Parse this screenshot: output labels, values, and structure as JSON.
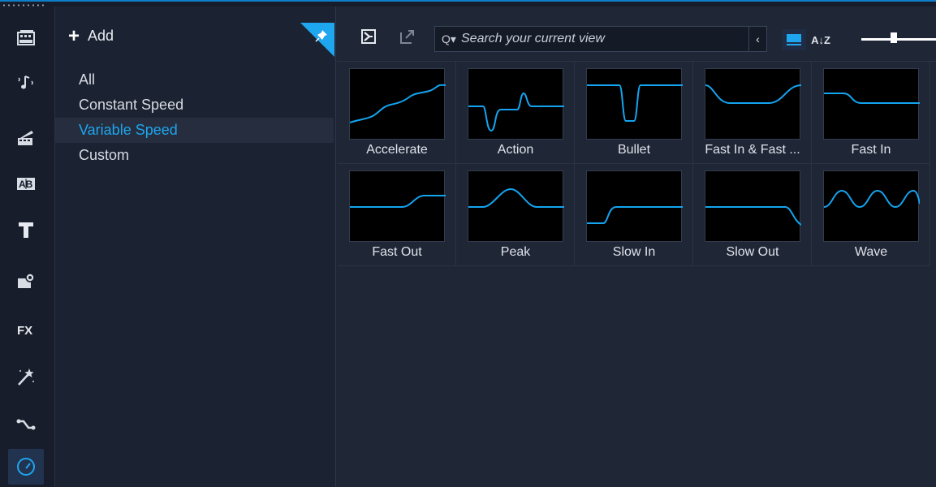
{
  "colors": {
    "accent": "#1ea6ee",
    "curve": "#14a4f0",
    "selected_category": "#1ea6ee"
  },
  "iconbar": {
    "items": [
      {
        "name": "media-icon"
      },
      {
        "name": "audio-icon"
      },
      {
        "name": "instant-project-icon"
      },
      {
        "name": "title-ab-icon",
        "text": "AB"
      },
      {
        "name": "text-icon",
        "text": "T"
      },
      {
        "name": "graphics-icon"
      },
      {
        "name": "fx-icon",
        "text": "FX"
      },
      {
        "name": "magic-wand-icon"
      },
      {
        "name": "motion-path-icon"
      },
      {
        "name": "speed-gauge-icon",
        "active": true
      }
    ]
  },
  "categories": {
    "add_label": "Add",
    "items": [
      "All",
      "Constant Speed",
      "Variable Speed",
      "Custom"
    ],
    "selected": "Variable Speed"
  },
  "toolbar": {
    "search_placeholder": "Search your current view",
    "search_icon_text": "Q▾",
    "clear_text": "‹",
    "sort_text": "A↓Z"
  },
  "presets": [
    {
      "label": "Accelerate"
    },
    {
      "label": "Action"
    },
    {
      "label": "Bullet"
    },
    {
      "label": "Fast In & Fast ..."
    },
    {
      "label": "Fast In"
    },
    {
      "label": "Fast Out"
    },
    {
      "label": "Peak"
    },
    {
      "label": "Slow In"
    },
    {
      "label": "Slow Out"
    },
    {
      "label": "Wave"
    }
  ]
}
